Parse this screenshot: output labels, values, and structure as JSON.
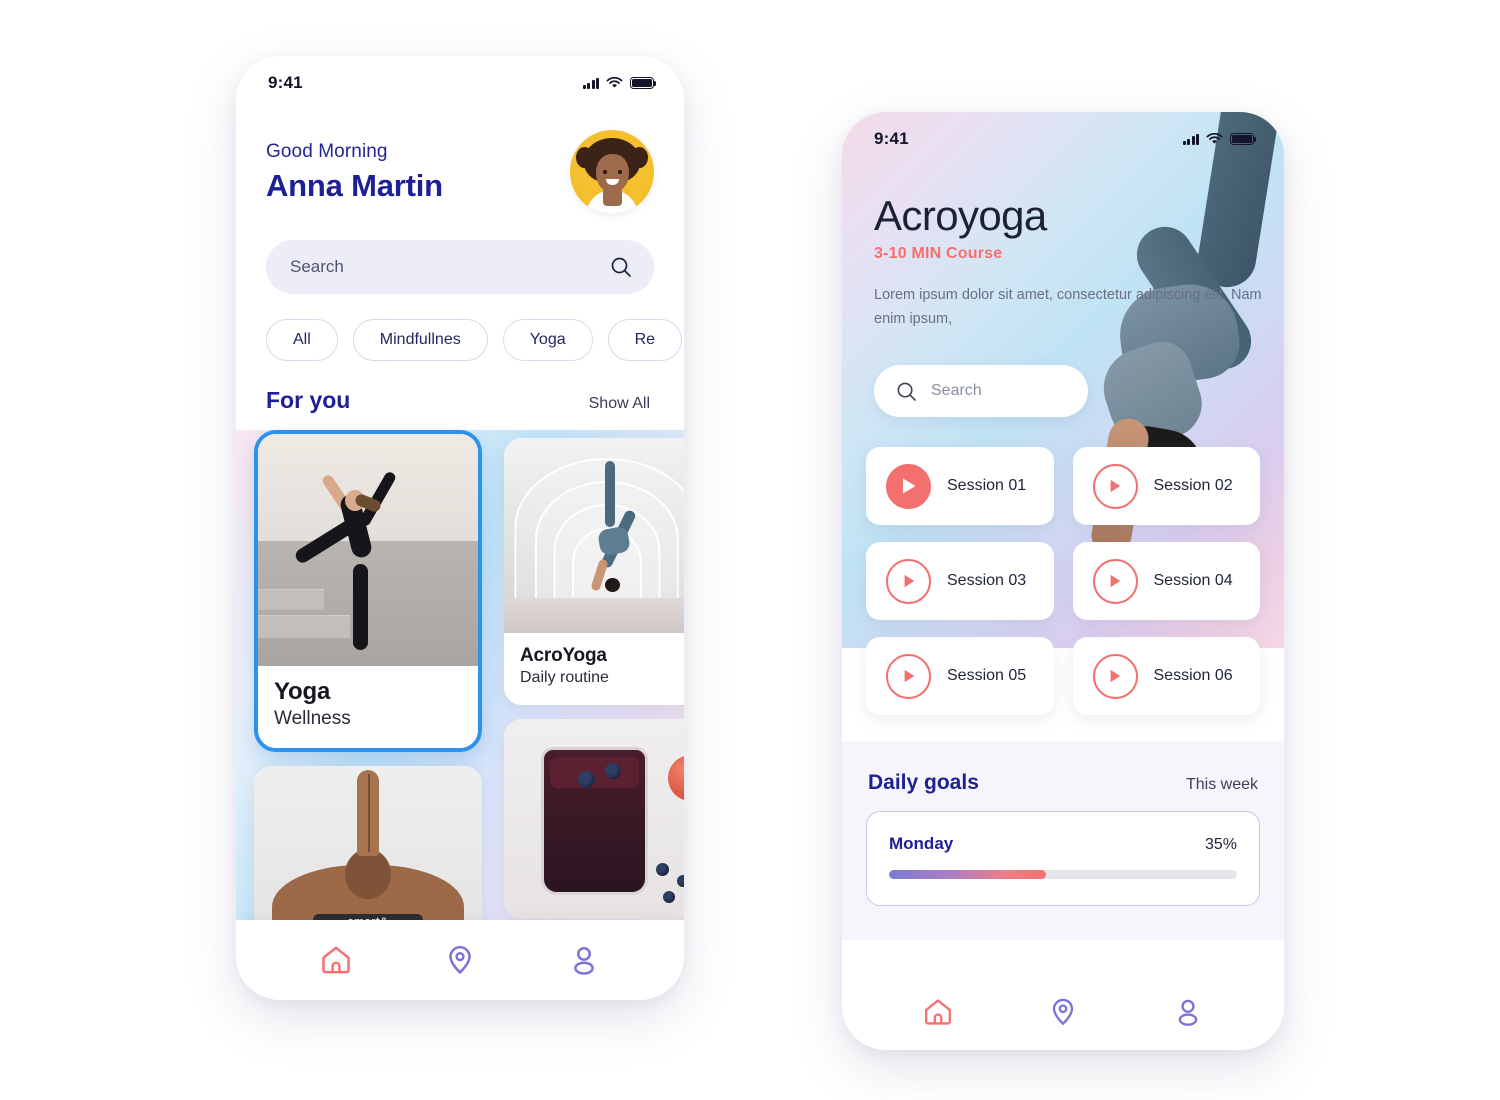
{
  "phone1": {
    "status": {
      "time": "9:41",
      "signal_icon": "signal-bars-icon",
      "wifi_icon": "wifi-icon",
      "battery_icon": "battery-full-icon"
    },
    "header": {
      "greeting": "Good Morning",
      "user_name": "Anna Martin",
      "avatar_label": "avatar"
    },
    "search": {
      "placeholder": "Search",
      "icon": "search-icon"
    },
    "filters": [
      {
        "label": "All"
      },
      {
        "label": "Mindfullnes"
      },
      {
        "label": "Yoga"
      },
      {
        "label": "Re"
      }
    ],
    "section": {
      "title": "For you",
      "link": "Show All"
    },
    "cards": [
      {
        "title": "Yoga",
        "subtitle": "Wellness",
        "selected": true
      },
      {
        "title": "AcroYoga",
        "subtitle": "Daily routine",
        "selected": false
      },
      {
        "title": "",
        "subtitle": "",
        "selected": false
      },
      {
        "title": "",
        "subtitle": "",
        "selected": false
      }
    ],
    "tabbar": [
      {
        "name": "home",
        "icon": "home-icon",
        "active": true,
        "color": "#f4706e"
      },
      {
        "name": "location",
        "icon": "location-pin-icon",
        "active": false,
        "color": "#7b73d8"
      },
      {
        "name": "profile",
        "icon": "user-icon",
        "active": false,
        "color": "#7b73d8"
      }
    ]
  },
  "phone2": {
    "status": {
      "time": "9:41",
      "signal_icon": "signal-bars-icon",
      "wifi_icon": "wifi-icon",
      "battery_icon": "battery-full-icon"
    },
    "hero": {
      "title": "Acroyoga",
      "course_badge": "3-10 MIN Course",
      "description": "Lorem ipsum dolor sit amet, consectetur adipiscing elit. Nam enim ipsum,"
    },
    "search": {
      "placeholder": "Search",
      "icon": "search-icon"
    },
    "sessions": [
      {
        "label": "Session 01",
        "playing": true
      },
      {
        "label": "Session 02",
        "playing": false
      },
      {
        "label": "Session 03",
        "playing": false
      },
      {
        "label": "Session 04",
        "playing": false
      },
      {
        "label": "Session 05",
        "playing": false
      },
      {
        "label": "Session 06",
        "playing": false
      }
    ],
    "goals": {
      "title": "Daily goals",
      "link": "This week",
      "day": "Monday",
      "percent_label": "35%",
      "percent_value": 45
    },
    "tabbar": [
      {
        "name": "home",
        "icon": "home-icon",
        "active": true,
        "color": "#f4706e"
      },
      {
        "name": "location",
        "icon": "location-pin-icon",
        "active": false,
        "color": "#7b73d8"
      },
      {
        "name": "profile",
        "icon": "user-icon",
        "active": false,
        "color": "#7b73d8"
      }
    ]
  },
  "theme": {
    "accent_red": "#f4706e",
    "accent_indigo": "#1e2096",
    "accent_purple": "#7b73d8",
    "selected_border": "#2b93ef",
    "search_bg": "#ededf7",
    "section_bg": "#f5f5fb"
  }
}
